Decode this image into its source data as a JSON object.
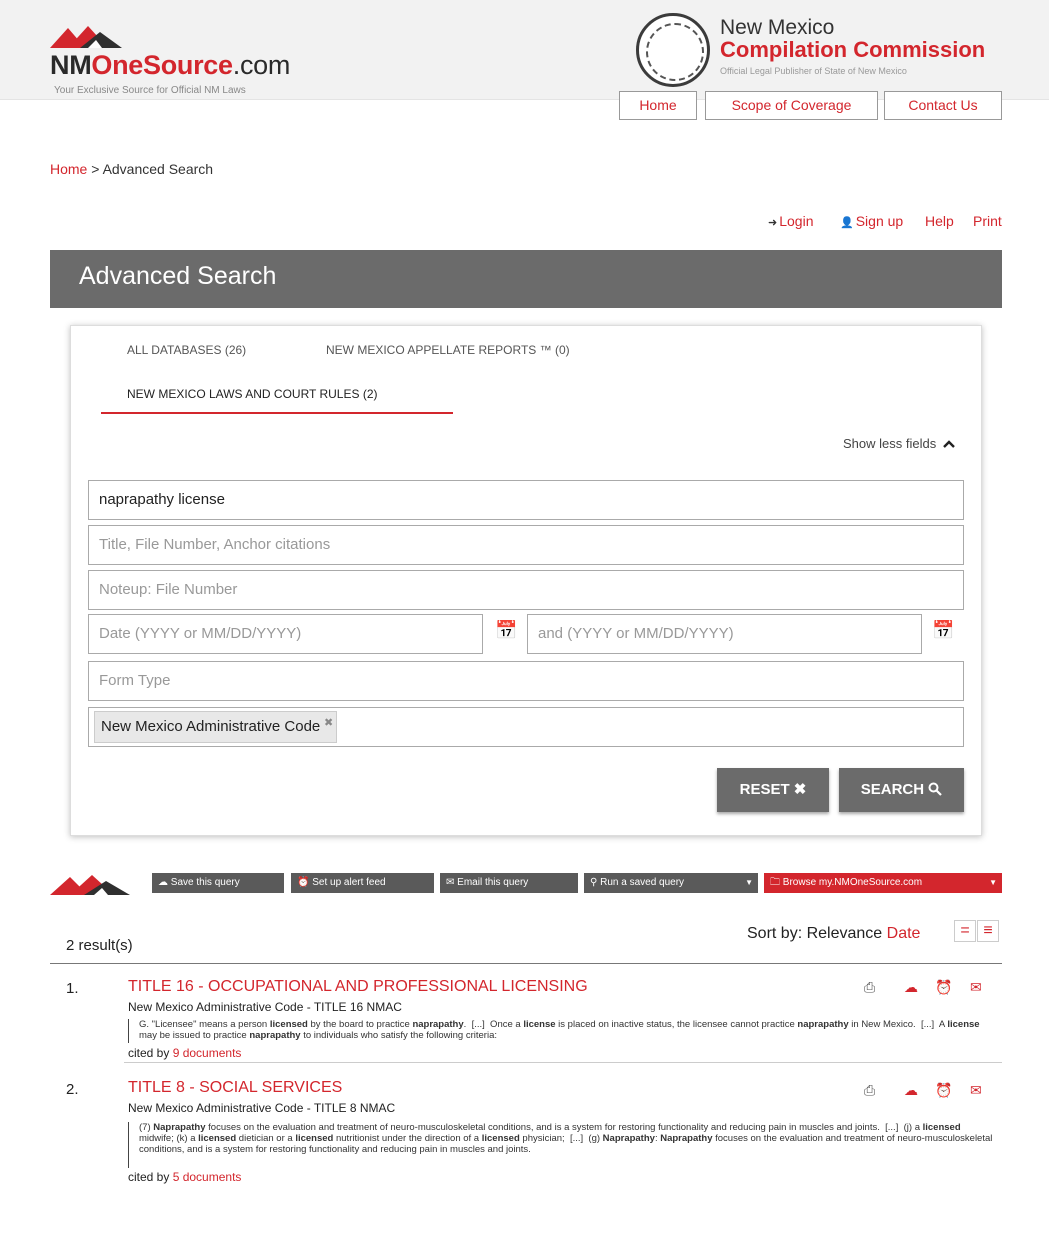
{
  "brand": {
    "logo_part1": "NM",
    "logo_part2": "OneSource",
    "logo_part3": ".com",
    "tagline": "Your Exclusive Source for Official NM Laws"
  },
  "commission": {
    "line1": "New Mexico",
    "line2": "Compilation Commission",
    "line3": "Official Legal Publisher of State of New Mexico"
  },
  "topnav": [
    "Home",
    "Scope of Coverage",
    "Contact Us"
  ],
  "breadcrumb": {
    "home": "Home",
    "separator": ">",
    "current": "Advanced Search"
  },
  "utility": {
    "login": "Login",
    "signup": "Sign up",
    "help": "Help",
    "print": "Print"
  },
  "page_title": "Advanced Search",
  "tabs": [
    {
      "label": "ALL DATABASES (26)"
    },
    {
      "label": "NEW MEXICO APPELLATE REPORTS ™ (0)"
    },
    {
      "label": "NEW MEXICO LAWS AND COURT RULES (2)",
      "active": true
    }
  ],
  "show_less": "Show less fields",
  "form": {
    "query_value": "naprapathy license",
    "title_placeholder": "Title, File Number, Anchor citations",
    "noteup_placeholder": "Noteup:  File Number",
    "date_from_placeholder": "Date (YYYY or MM/DD/YYYY)",
    "date_to_placeholder": "and (YYYY or MM/DD/YYYY)",
    "form_type_placeholder": "Form Type",
    "filter_chip": "New Mexico Administrative Code"
  },
  "buttons": {
    "reset": "RESET",
    "search": "SEARCH"
  },
  "toolbar": {
    "save": "Save this query",
    "alert": "Set up alert feed",
    "email": "Email this query",
    "run": "Run a saved query",
    "browse": "Browse my.NMOneSource.com"
  },
  "results_count": "2 result(s)",
  "sort": {
    "label": "Sort by:",
    "relevance": "Relevance",
    "date": "Date"
  },
  "results": [
    {
      "num": "1.",
      "title": "TITLE 16 - OCCUPATIONAL AND PROFESSIONAL LICENSING",
      "source": "New Mexico Administrative Code - TITLE 16 NMAC",
      "cited_prefix": "cited by",
      "cited_count": "9 documents"
    },
    {
      "num": "2.",
      "title": "TITLE 8 - SOCIAL SERVICES",
      "source": "New Mexico Administrative Code - TITLE 8 NMAC",
      "cited_prefix": "cited by",
      "cited_count": "5 documents"
    }
  ],
  "icons": {
    "pdf": "pdf-icon",
    "cloud": "cloud-save-icon",
    "alarm": "alarm-clock-icon",
    "email": "envelope-icon",
    "calendar": "calendar-icon"
  },
  "colors": {
    "accent": "#d3262d",
    "header_gray": "#6b6b6b"
  }
}
